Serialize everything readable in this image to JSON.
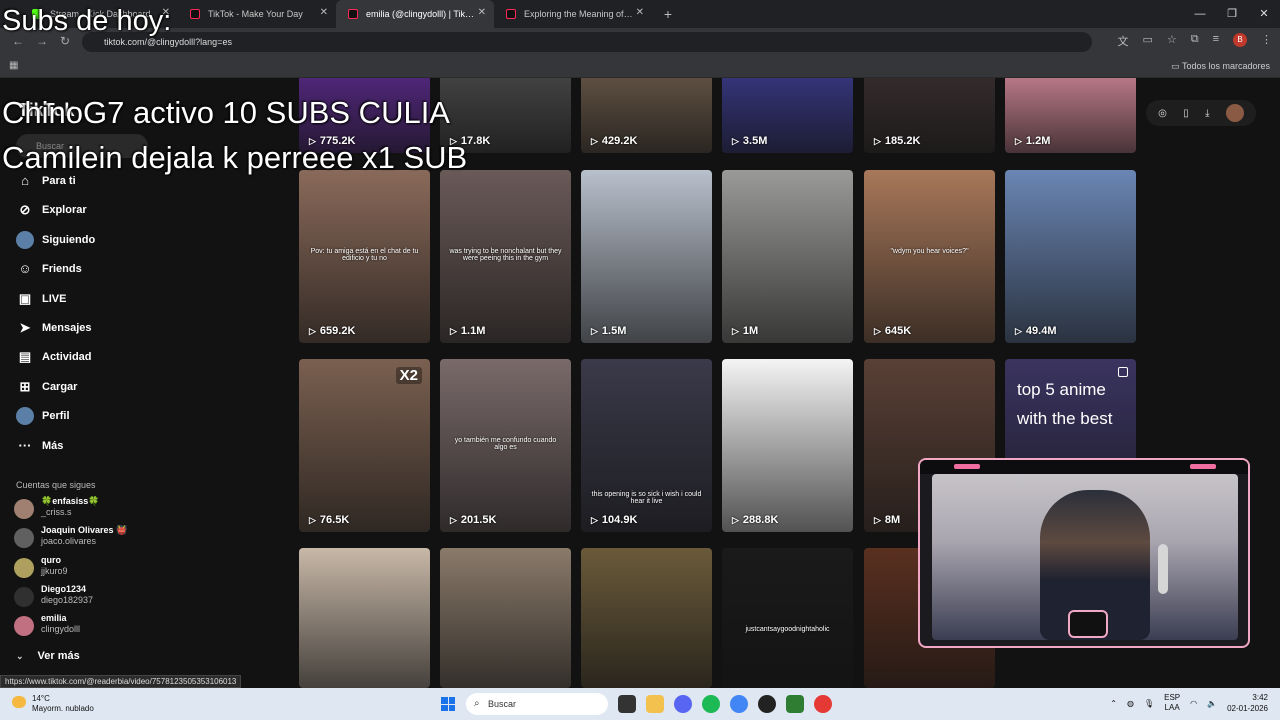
{
  "browser": {
    "tabs": [
      {
        "label": "Stream - Kick Dashboard",
        "icon": "kick-icon",
        "active": false
      },
      {
        "label": "TikTok - Make Your Day",
        "icon": "tiktok-icon",
        "active": false
      },
      {
        "label": "emilia (@clingydolll) | TikTok",
        "icon": "tiktok-icon",
        "active": true
      },
      {
        "label": "Exploring the Meaning of Nana",
        "icon": "tiktok-icon",
        "active": false
      }
    ],
    "new_tab": "+",
    "url": "tiktok.com/@clingydolll?lang=es",
    "bookmarks_folder": "Todos los marcadores",
    "profile_initial": "B"
  },
  "overlay": {
    "title": "Subs de hoy:",
    "lines": [
      "ChinoG7 activo 10 SUBS CULIA",
      "Camilein dejala k perreee x1 SUB"
    ]
  },
  "tiktok": {
    "logo": "TikTok",
    "search_placeholder": "Buscar",
    "nav": [
      {
        "label": "Para ti",
        "icon": "home-icon"
      },
      {
        "label": "Explorar",
        "icon": "compass-icon"
      },
      {
        "label": "Siguiendo",
        "icon": "following-avatar-icon"
      },
      {
        "label": "Friends",
        "icon": "friends-icon"
      },
      {
        "label": "LIVE",
        "icon": "live-icon"
      },
      {
        "label": "Mensajes",
        "icon": "send-icon"
      },
      {
        "label": "Actividad",
        "icon": "activity-icon"
      },
      {
        "label": "Cargar",
        "icon": "upload-icon"
      },
      {
        "label": "Perfil",
        "icon": "profile-avatar-icon"
      },
      {
        "label": "Más",
        "icon": "more-icon"
      }
    ],
    "following_title": "Cuentas que sigues",
    "following": [
      {
        "name": "🍀enfasiss🍀",
        "handle": "_criss.s"
      },
      {
        "name": "Joaquin Olivares 👹",
        "handle": "joaco.olivares"
      },
      {
        "name": "quro",
        "handle": "jjkuro9"
      },
      {
        "name": "Diego1234",
        "handle": "diego182937"
      },
      {
        "name": "emilia",
        "handle": "clingydolll"
      }
    ],
    "see_more": "Ver más",
    "videos": [
      {
        "views": "775.2K",
        "color": "#5a2a8a"
      },
      {
        "views": "17.8K",
        "color": "#4a4a4a"
      },
      {
        "views": "429.2K",
        "color": "#6b5a4a"
      },
      {
        "views": "3.5M",
        "color": "#3a3a8a"
      },
      {
        "views": "185.2K",
        "color": "#3a3030"
      },
      {
        "views": "1.2M",
        "color": "#d48a9a"
      },
      {
        "views": "659.2K",
        "color": "#8a6a5a",
        "caption": "Pov: tu amiga está en el chat de tu edificio y tu no"
      },
      {
        "views": "1.1M",
        "color": "#6a5a58",
        "caption": "was trying to be nonchalant but they were peeing this in the gym"
      },
      {
        "views": "1.5M",
        "color": "#b8c0cc"
      },
      {
        "views": "1M",
        "color": "#9a9a98"
      },
      {
        "views": "645K",
        "color": "#a8785a",
        "caption": "\"wdym you hear voices?\""
      },
      {
        "views": "49.4M",
        "color": "#6a86b4"
      },
      {
        "views": "76.5K",
        "color": "#7a6050",
        "badge": "X2"
      },
      {
        "views": "201.5K",
        "color": "#7a6a6a",
        "caption": "yo también me confundo cuando algo es"
      },
      {
        "views": "104.9K",
        "color": "#3a3a4a",
        "caption": "this opening is so sick i wish i could hear it live"
      },
      {
        "views": "288.8K",
        "color": "#f4f4f4"
      },
      {
        "views": "8M",
        "color": "#5a4036"
      },
      {
        "views": "",
        "color": "#3a3460",
        "bigtext": "top 5 anime with the best"
      },
      {
        "views": "",
        "color": "#c8b8a8"
      },
      {
        "views": "",
        "color": "#8a7a6a"
      },
      {
        "views": "",
        "color": "#6a5a3a"
      },
      {
        "views": "",
        "color": "#1a1a1a",
        "caption": "justcantsaygoodnightaholic"
      },
      {
        "views": "",
        "color": "#5a3020"
      }
    ]
  },
  "status_url": "https://www.tiktok.com/@readerbia/video/7578123505353106013",
  "taskbar": {
    "weather_temp": "14°C",
    "weather_desc": "Mayorm. nublado",
    "search_placeholder": "Buscar",
    "lang_top": "ESP",
    "lang_bottom": "LAA",
    "time": "3:42",
    "date": "02-01-2026"
  },
  "colors": {
    "accent_pink": "#f2a7c4",
    "tiktok_bg": "#121212",
    "chrome_bg": "#202124"
  }
}
